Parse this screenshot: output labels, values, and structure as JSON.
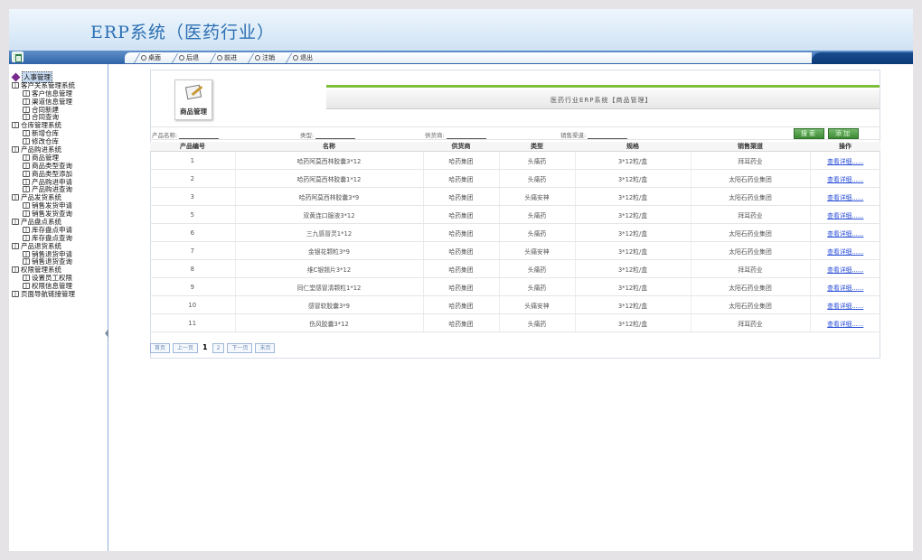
{
  "app": {
    "title": "ERP系统（医药行业）"
  },
  "toolbar": {
    "buttons": [
      {
        "label": "桌面"
      },
      {
        "label": "后退"
      },
      {
        "label": "前进"
      },
      {
        "label": "注销"
      },
      {
        "label": "退出"
      }
    ]
  },
  "sidebar": {
    "items": [
      {
        "label": "人事管理",
        "level": 0,
        "current": true
      },
      {
        "label": "客户关系管理系统",
        "level": 0
      },
      {
        "label": "客户信息管理",
        "level": 1
      },
      {
        "label": "渠道信息管理",
        "level": 1
      },
      {
        "label": "合同新建",
        "level": 1
      },
      {
        "label": "合同查询",
        "level": 1
      },
      {
        "label": "仓库管理系统",
        "level": 0
      },
      {
        "label": "新增仓库",
        "level": 1
      },
      {
        "label": "修改仓库",
        "level": 1
      },
      {
        "label": "产品购进系统",
        "level": 0
      },
      {
        "label": "商品管理",
        "level": 1
      },
      {
        "label": "商品类型查询",
        "level": 1
      },
      {
        "label": "商品类型添加",
        "level": 1
      },
      {
        "label": "产品购进申请",
        "level": 1
      },
      {
        "label": "产品购进查询",
        "level": 1
      },
      {
        "label": "产品发货系统",
        "level": 0
      },
      {
        "label": "销售发货申请",
        "level": 1
      },
      {
        "label": "销售发货查询",
        "level": 1
      },
      {
        "label": "产品盘点系统",
        "level": 0
      },
      {
        "label": "库存盘点申请",
        "level": 1
      },
      {
        "label": "库存盘点查询",
        "level": 1
      },
      {
        "label": "产品退货系统",
        "level": 0
      },
      {
        "label": "销售退货申请",
        "level": 1
      },
      {
        "label": "销售退货查询",
        "level": 1
      },
      {
        "label": "权限管理系统",
        "level": 0
      },
      {
        "label": "设置员工权限",
        "level": 1
      },
      {
        "label": "权限信息管理",
        "level": 1
      },
      {
        "label": "页面导航链接管理",
        "level": 0
      }
    ]
  },
  "module": {
    "icon_label": "商品管理",
    "banner": "医药行业ERP系统【商品管理】"
  },
  "search": {
    "name_label": "产品名称:",
    "type_label": "类型:",
    "supplier_label": "供货商:",
    "channel_label": "销售渠道:",
    "search_button": "搜索",
    "add_button": "添加"
  },
  "table": {
    "columns": [
      "产品编号",
      "名称",
      "供货商",
      "类型",
      "规格",
      "销售渠道",
      "操作"
    ],
    "rows": [
      [
        "1",
        "哈药阿莫西林胶囊3*12",
        "哈药集团",
        "头痛药",
        "3*12粒/盒",
        "拜耳药业",
        "查看详细......"
      ],
      [
        "2",
        "哈药阿莫西林胶囊1*12",
        "哈药集团",
        "头痛药",
        "3*12粒/盒",
        "太阳石药业集团",
        "查看详细......"
      ],
      [
        "3",
        "哈药阿莫西林胶囊3*9",
        "哈药集团",
        "头痛安神",
        "3*12粒/盒",
        "太阳石药业集团",
        "查看详细......"
      ],
      [
        "5",
        "双黄连口服液3*12",
        "哈药集团",
        "头痛药",
        "3*12粒/盒",
        "拜耳药业",
        "查看详细......"
      ],
      [
        "6",
        "三九感冒灵1*12",
        "哈药集团",
        "头痛药",
        "3*12粒/盒",
        "太阳石药业集团",
        "查看详细......"
      ],
      [
        "7",
        "金银花颗粒3*9",
        "哈药集团",
        "头痛安神",
        "3*12粒/盒",
        "太阳石药业集团",
        "查看详细......"
      ],
      [
        "8",
        "维C银翘片3*12",
        "哈药集团",
        "头痛药",
        "3*12粒/盒",
        "拜耳药业",
        "查看详细......"
      ],
      [
        "9",
        "同仁堂感冒清颗粒1*12",
        "哈药集团",
        "头痛药",
        "3*12粒/盒",
        "太阳石药业集团",
        "查看详细......"
      ],
      [
        "10",
        "感冒软胶囊3*9",
        "哈药集团",
        "头痛安神",
        "3*12粒/盒",
        "太阳石药业集团",
        "查看详细......"
      ],
      [
        "11",
        "伤风胶囊3*12",
        "哈药集团",
        "头痛药",
        "3*12粒/盒",
        "拜耳药业",
        "查看详细......"
      ]
    ]
  },
  "pager": {
    "first": "首页",
    "prev": "上一页",
    "pages": [
      "1",
      "2"
    ],
    "next": "下一页",
    "last": "末页"
  }
}
